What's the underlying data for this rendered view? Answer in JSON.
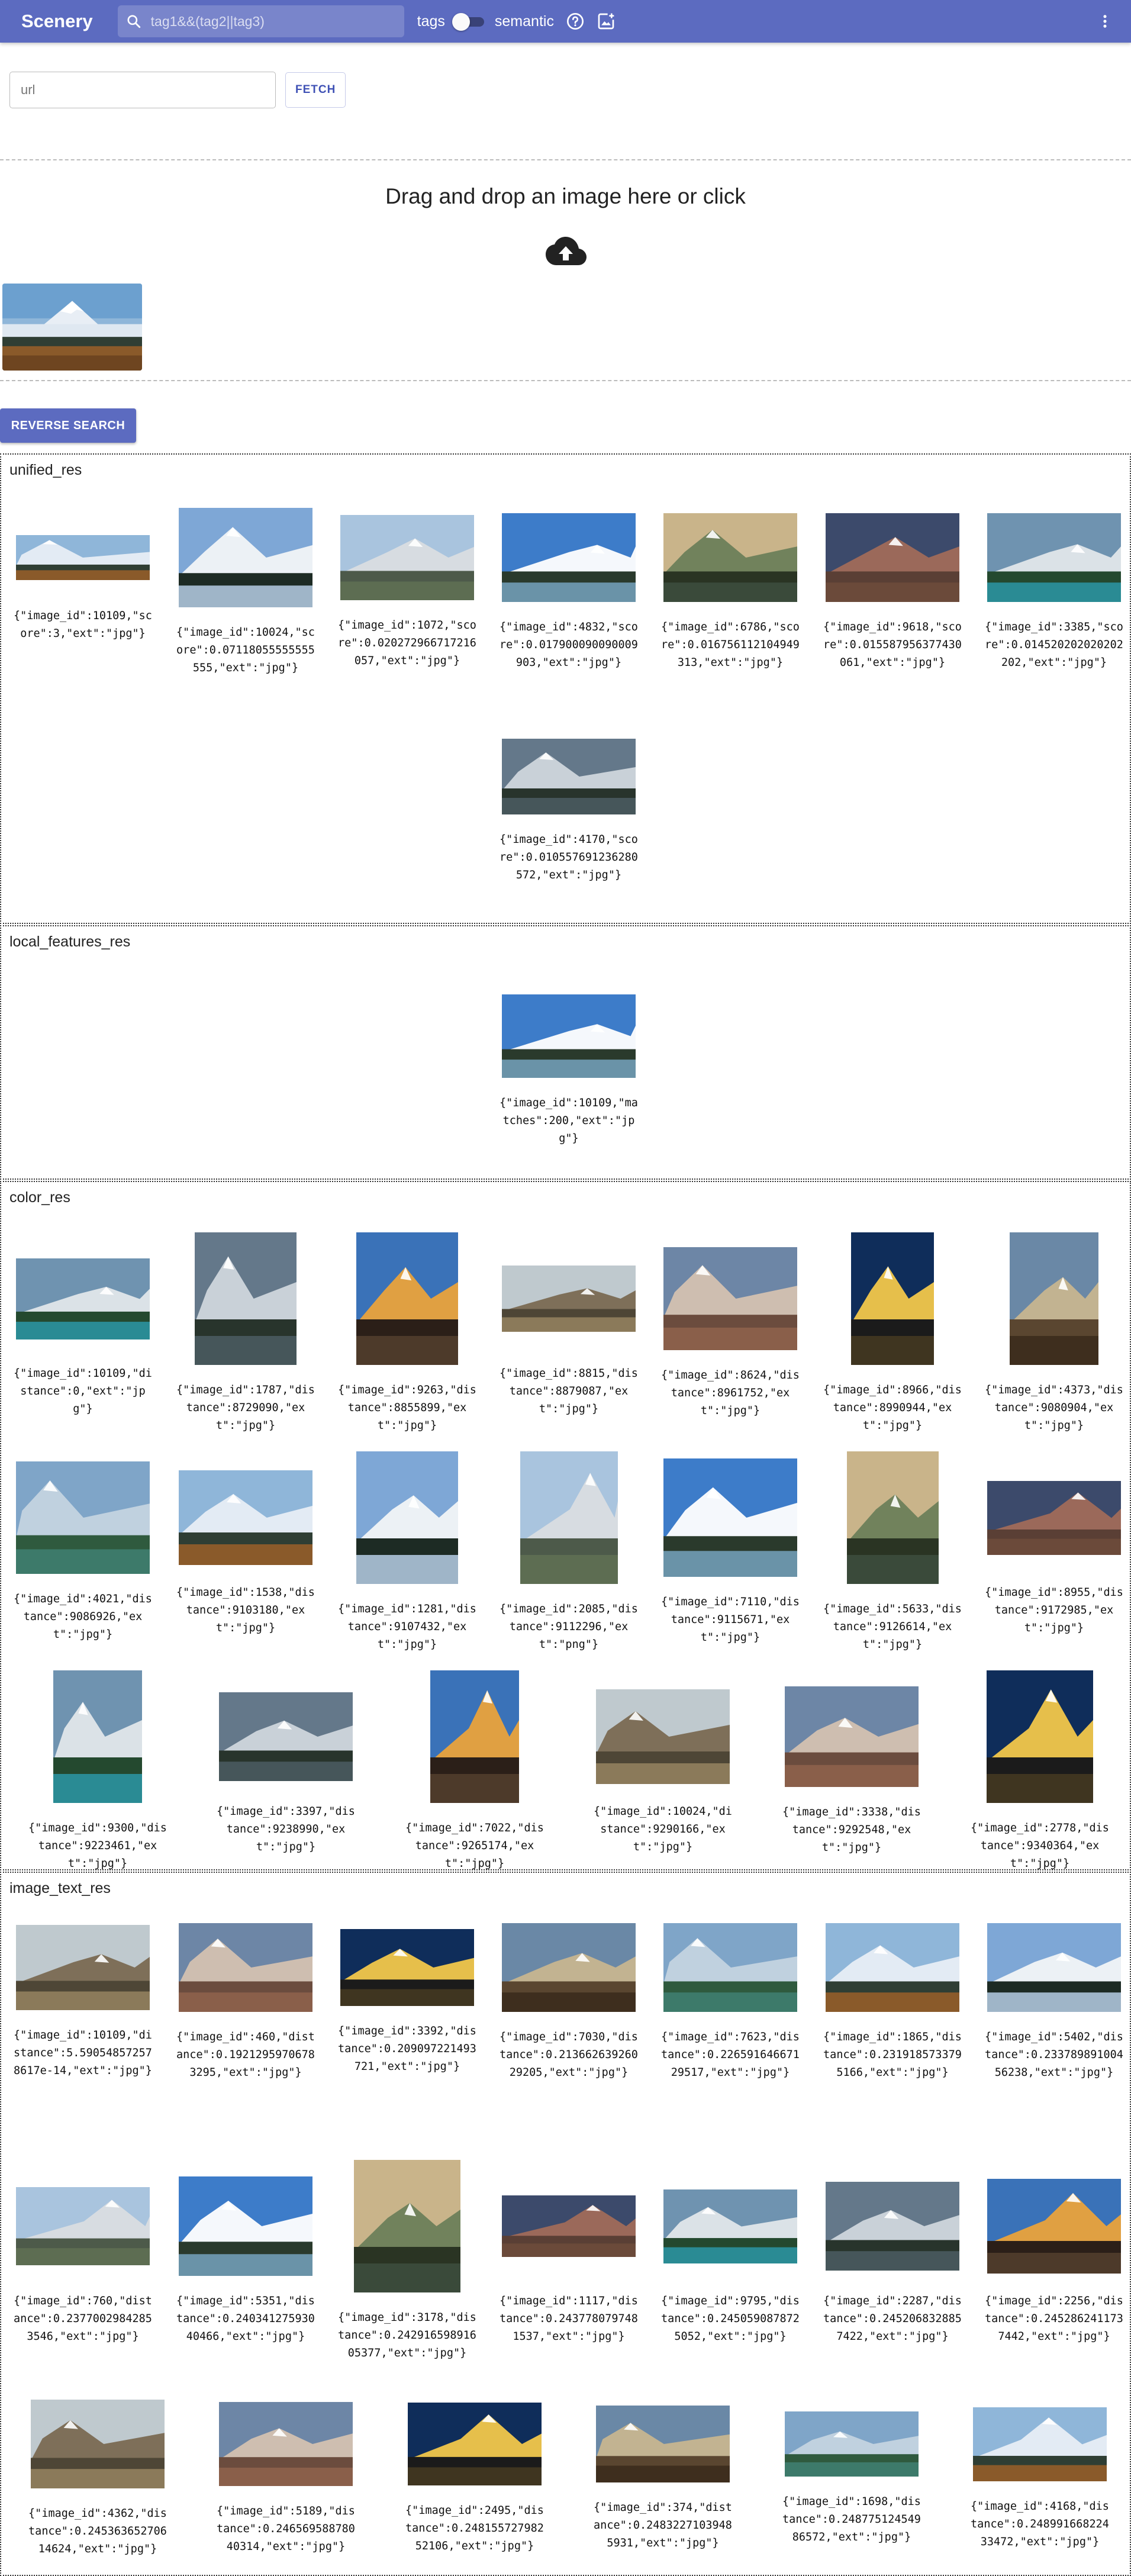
{
  "app": {
    "title": "Scenery"
  },
  "search": {
    "placeholder": "tag1&&(tag2||tag3)"
  },
  "toggles": {
    "tags_label": "tags",
    "semantic_label": "semantic"
  },
  "icons": {
    "search": "search-icon",
    "help": "help-circle-icon",
    "upload": "image-upload-icon",
    "more": "more-vert-icon",
    "cloud": "cloud-upload-icon"
  },
  "colors": {
    "primary": "#5c6bc0",
    "accent": "#3f51b5"
  },
  "url_form": {
    "placeholder": "url",
    "fetch_label": "FETCH"
  },
  "dropzone": {
    "text": "Drag and drop an image here or click"
  },
  "reverse_search_label": "REVERSE SEARCH",
  "sections": [
    {
      "title": "unified_res",
      "items": [
        "{\"image_id\":10109,\"score\":3,\"ext\":\"jpg\"}",
        "{\"image_id\":10024,\"score\":0.07118055555555555,\"ext\":\"jpg\"}",
        "{\"image_id\":1072,\"score\":0.020272966717216057,\"ext\":\"jpg\"}",
        "{\"image_id\":4832,\"score\":0.017900090090009903,\"ext\":\"jpg\"}",
        "{\"image_id\":6786,\"score\":0.016756112104949313,\"ext\":\"jpg\"}",
        "{\"image_id\":9618,\"score\":0.015587956377430061,\"ext\":\"jpg\"}",
        "{\"image_id\":3385,\"score\":0.014520202020202202,\"ext\":\"jpg\"}",
        "{\"image_id\":4170,\"score\":0.010557691236280572,\"ext\":\"jpg\"}"
      ]
    },
    {
      "title": "local_features_res",
      "items": [
        "{\"image_id\":10109,\"matches\":200,\"ext\":\"jpg\"}"
      ]
    },
    {
      "title": "color_res",
      "items": [
        "{\"image_id\":10109,\"distance\":0,\"ext\":\"jpg\"}",
        "{\"image_id\":1787,\"distance\":8729090,\"ext\":\"jpg\"}",
        "{\"image_id\":9263,\"distance\":8855899,\"ext\":\"jpg\"}",
        "{\"image_id\":8815,\"distance\":8879087,\"ext\":\"jpg\"}",
        "{\"image_id\":8624,\"distance\":8961752,\"ext\":\"jpg\"}",
        "{\"image_id\":8966,\"distance\":8990944,\"ext\":\"jpg\"}",
        "{\"image_id\":4373,\"distance\":9080904,\"ext\":\"jpg\"}",
        "{\"image_id\":4021,\"distance\":9086926,\"ext\":\"jpg\"}",
        "{\"image_id\":1538,\"distance\":9103180,\"ext\":\"jpg\"}",
        "{\"image_id\":1281,\"distance\":9107432,\"ext\":\"jpg\"}",
        "{\"image_id\":2085,\"distance\":9112296,\"ext\":\"png\"}",
        "{\"image_id\":7110,\"distance\":9115671,\"ext\":\"jpg\"}",
        "{\"image_id\":5633,\"distance\":9126614,\"ext\":\"jpg\"}",
        "{\"image_id\":8955,\"distance\":9172985,\"ext\":\"jpg\"}",
        "{\"image_id\":9300,\"distance\":9223461,\"ext\":\"jpg\"}",
        "{\"image_id\":3397,\"distance\":9238990,\"ext\":\"jpg\"}",
        "{\"image_id\":7022,\"distance\":9265174,\"ext\":\"jpg\"}",
        "{\"image_id\":10024,\"distance\":9290166,\"ext\":\"jpg\"}",
        "{\"image_id\":3338,\"distance\":9292548,\"ext\":\"jpg\"}",
        "{\"image_id\":2778,\"distance\":9340364,\"ext\":\"jpg\"}"
      ]
    },
    {
      "title": "image_text_res",
      "items": [
        "{\"image_id\":10109,\"distance\":5.590548572578617e-14,\"ext\":\"jpg\"}",
        "{\"image_id\":460,\"distance\":0.19212959706783295,\"ext\":\"jpg\"}",
        "{\"image_id\":3392,\"distance\":0.209097221493721,\"ext\":\"jpg\"}",
        "{\"image_id\":7030,\"distance\":0.21366263926029205,\"ext\":\"jpg\"}",
        "{\"image_id\":7623,\"distance\":0.22659164667129517,\"ext\":\"jpg\"}",
        "{\"image_id\":1865,\"distance\":0.2319185733795166,\"ext\":\"jpg\"}",
        "{\"image_id\":5402,\"distance\":0.23378989100456238,\"ext\":\"jpg\"}",
        "{\"image_id\":760,\"distance\":0.23770029842853546,\"ext\":\"jpg\"}",
        "{\"image_id\":5351,\"distance\":0.24034127593040466,\"ext\":\"jpg\"}",
        "{\"image_id\":3178,\"distance\":0.24291659891605377,\"ext\":\"jpg\"}",
        "{\"image_id\":1117,\"distance\":0.2437780797481537,\"ext\":\"jpg\"}",
        "{\"image_id\":9795,\"distance\":0.2450590878725052,\"ext\":\"jpg\"}",
        "{\"image_id\":2287,\"distance\":0.2452068328857422,\"ext\":\"jpg\"}",
        "{\"image_id\":2256,\"distance\":0.2452862411737442,\"ext\":\"jpg\"}",
        "{\"image_id\":4362,\"distance\":0.24536365270614624,\"ext\":\"jpg\"}",
        "{\"image_id\":5189,\"distance\":0.24656958878040314,\"ext\":\"jpg\"}",
        "{\"image_id\":2495,\"distance\":0.24815572798252106,\"ext\":\"jpg\"}",
        "{\"image_id\":374,\"distance\":0.24832271039485931,\"ext\":\"jpg\"}",
        "{\"image_id\":1698,\"distance\":0.24877512454986572,\"ext\":\"jpg\"}",
        "{\"image_id\":4168,\"distance\":0.24899166822433472,\"ext\":\"jpg\"}"
      ]
    }
  ]
}
